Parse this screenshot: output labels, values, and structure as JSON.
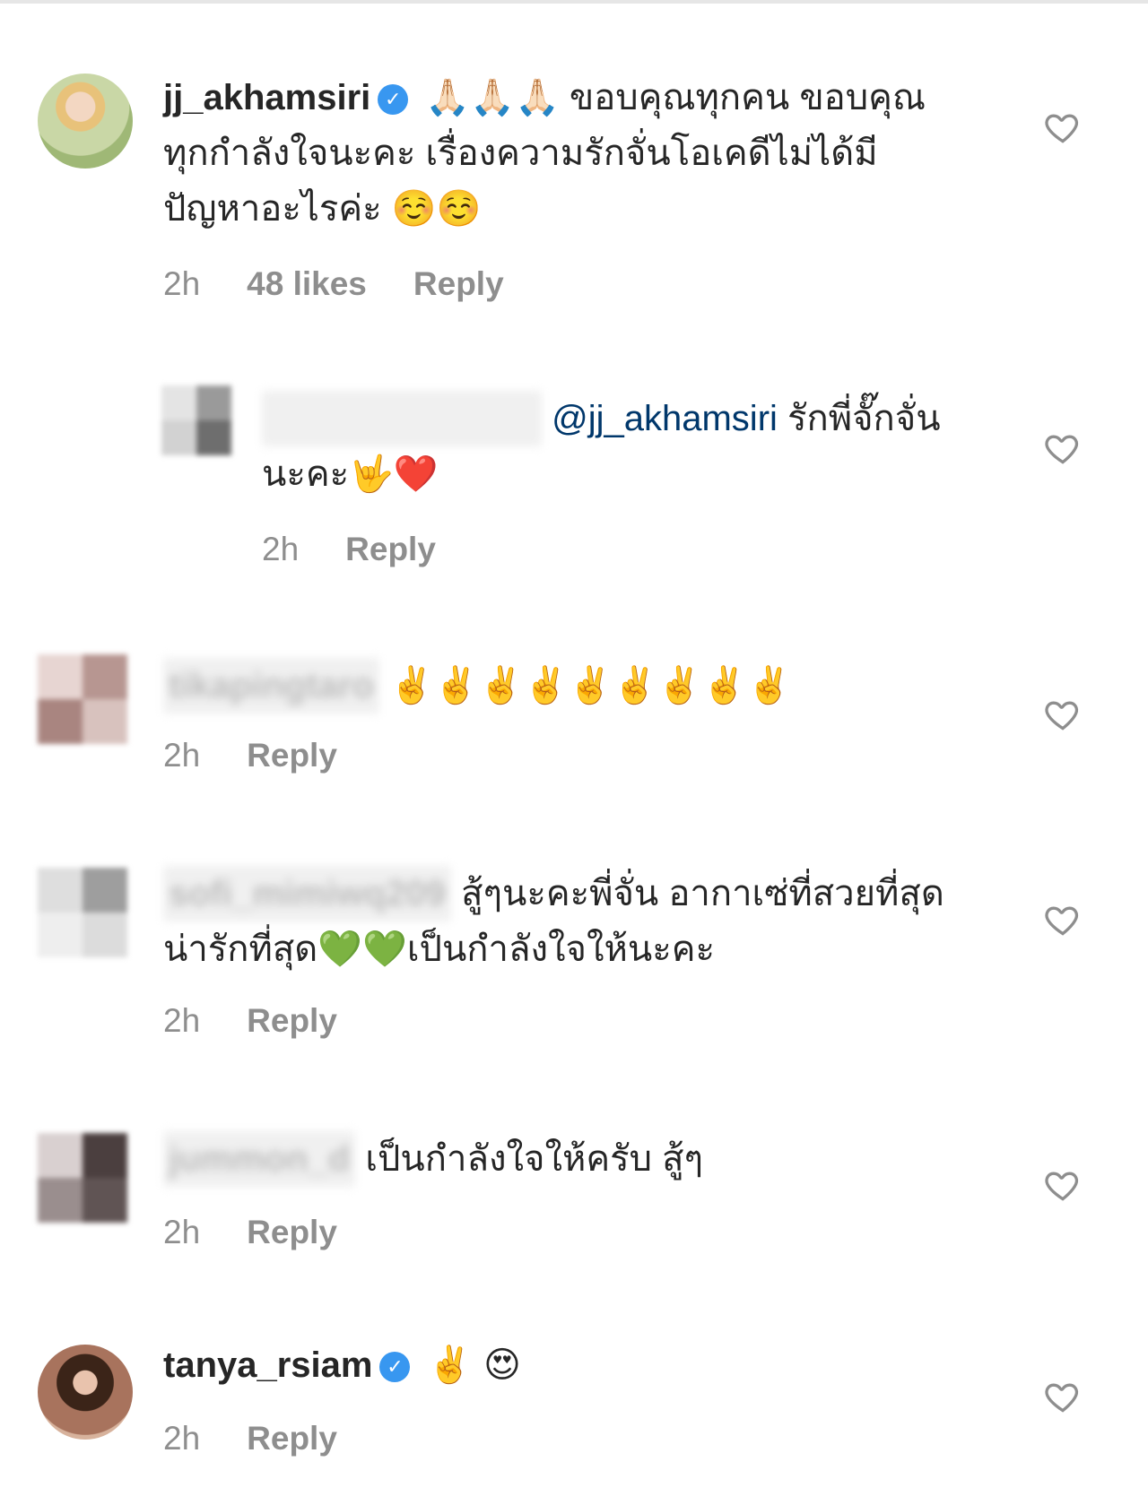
{
  "comments": [
    {
      "username": "jj_akhamsiri",
      "verified": true,
      "text": "🙏🏻🙏🏻🙏🏻 ขอบคุณทุกคน ขอบคุณทุกกำลังใจนะคะ เรื่องความรักจั่นโอเคดีไม่ได้มีปัญหาอะไรค่ะ ☺️☺️",
      "time": "2h",
      "likes": "48 likes",
      "reply": "Reply"
    },
    {
      "username": "",
      "verified": false,
      "mention": "@jj_akhamsiri",
      "text": "รักพี่จั๊กจั่นนะคะ🤟❤️",
      "time": "2h",
      "reply": "Reply"
    },
    {
      "username": "tikapingtaro",
      "verified": false,
      "text": "✌️✌️✌️✌️✌️✌️✌️✌️✌️",
      "time": "2h",
      "reply": "Reply"
    },
    {
      "username": "sofi_mimiwq209",
      "verified": false,
      "text": "สู้ๆนะคะพี่จั่น อากาเซ่ที่สวยที่สุด น่ารักที่สุด💚💚เป็นกำลังใจให้นะคะ",
      "time": "2h",
      "reply": "Reply"
    },
    {
      "username": "jummon_d",
      "verified": false,
      "text": "เป็นกำลังใจให้ครับ สู้ๆ",
      "time": "2h",
      "reply": "Reply"
    },
    {
      "username": "tanya_rsiam",
      "verified": true,
      "text": "✌️ 😍",
      "time": "2h",
      "reply": "Reply"
    }
  ]
}
